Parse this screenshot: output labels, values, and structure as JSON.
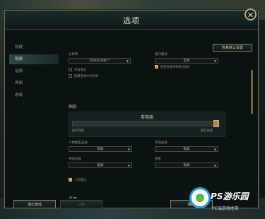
{
  "dialog": {
    "title": "选项",
    "close_glyph": "✕"
  },
  "sidebar": {
    "items": [
      {
        "label": "热键"
      },
      {
        "label": "视频"
      },
      {
        "label": "音频"
      },
      {
        "label": "界面"
      },
      {
        "label": "游戏"
      }
    ],
    "active_index": 1
  },
  "content": {
    "restore_defaults": "恢复默认设置",
    "resolution_label": "分辨率",
    "resolution_value": "1920x1080 *",
    "window_mode_label": "窗口模式",
    "window_mode_value": "全屏",
    "chk_colorblind": "色盲模式",
    "chk_hide_eye_candy": "隐藏游戏中的特效",
    "chk_best_perf": "使用帧速率限制(低配)",
    "graphics_section": "图形",
    "graphics_level": "非常高",
    "slider_left": "最佳性能",
    "slider_right": "最佳画质",
    "character_quality_label": "人物模型品质",
    "character_quality_value": "很高",
    "environment_quality_label": "环境品质",
    "environment_quality_value": "很高",
    "effects_quality_label": "特效品质",
    "effects_quality_value": "很高",
    "shadows_label": "阴影",
    "shadows_value": "很高",
    "chk_character_ink": "人物描边",
    "interface_section": "界面"
  },
  "footer": {
    "exit_game": "退出游戏",
    "confirm": "认证",
    "cancel": "确定"
  },
  "watermark": {
    "text": "PS游乐园",
    "sub": "PC端游戏地带"
  },
  "colors": {
    "accent_gold": "#c79a32",
    "border_gold": "#8a7b52"
  }
}
